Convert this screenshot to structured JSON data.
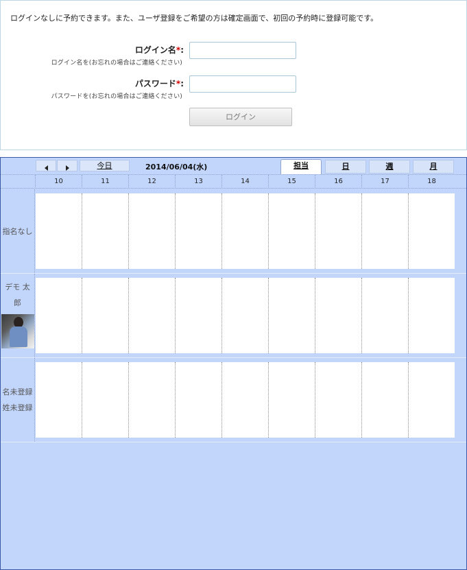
{
  "login": {
    "notice": "ログインなしに予約できます。また、ユーザ登録をご希望の方は確定画面で、初回の予約時に登録可能です。",
    "username_label": "ログイン名",
    "password_label": "パスワード",
    "required_mark": "*",
    "label_colon": ":",
    "username_hint": "ログイン名を(お忘れの場合はご連絡ください)",
    "password_hint": "パスワードを(お忘れの場合はご連絡ください)",
    "username_value": "",
    "password_value": "",
    "login_button": "ログイン"
  },
  "calendar": {
    "today_button": "今日",
    "date": "2014/06/04(水)",
    "view_tabs": [
      "担当",
      "日",
      "週",
      "月"
    ],
    "active_tab": "担当",
    "hours": [
      "10",
      "11",
      "12",
      "13",
      "14",
      "15",
      "16",
      "17",
      "18"
    ],
    "staff": [
      {
        "name": "指名なし",
        "has_photo": false
      },
      {
        "name": "デモ 太郎",
        "has_photo": true
      },
      {
        "name": "名未登録 姓未登録",
        "has_photo": false
      }
    ]
  },
  "colors": {
    "calendar_bg": "#c2d5fb",
    "required": "#d00000",
    "grid_bg": "#ffffff"
  }
}
